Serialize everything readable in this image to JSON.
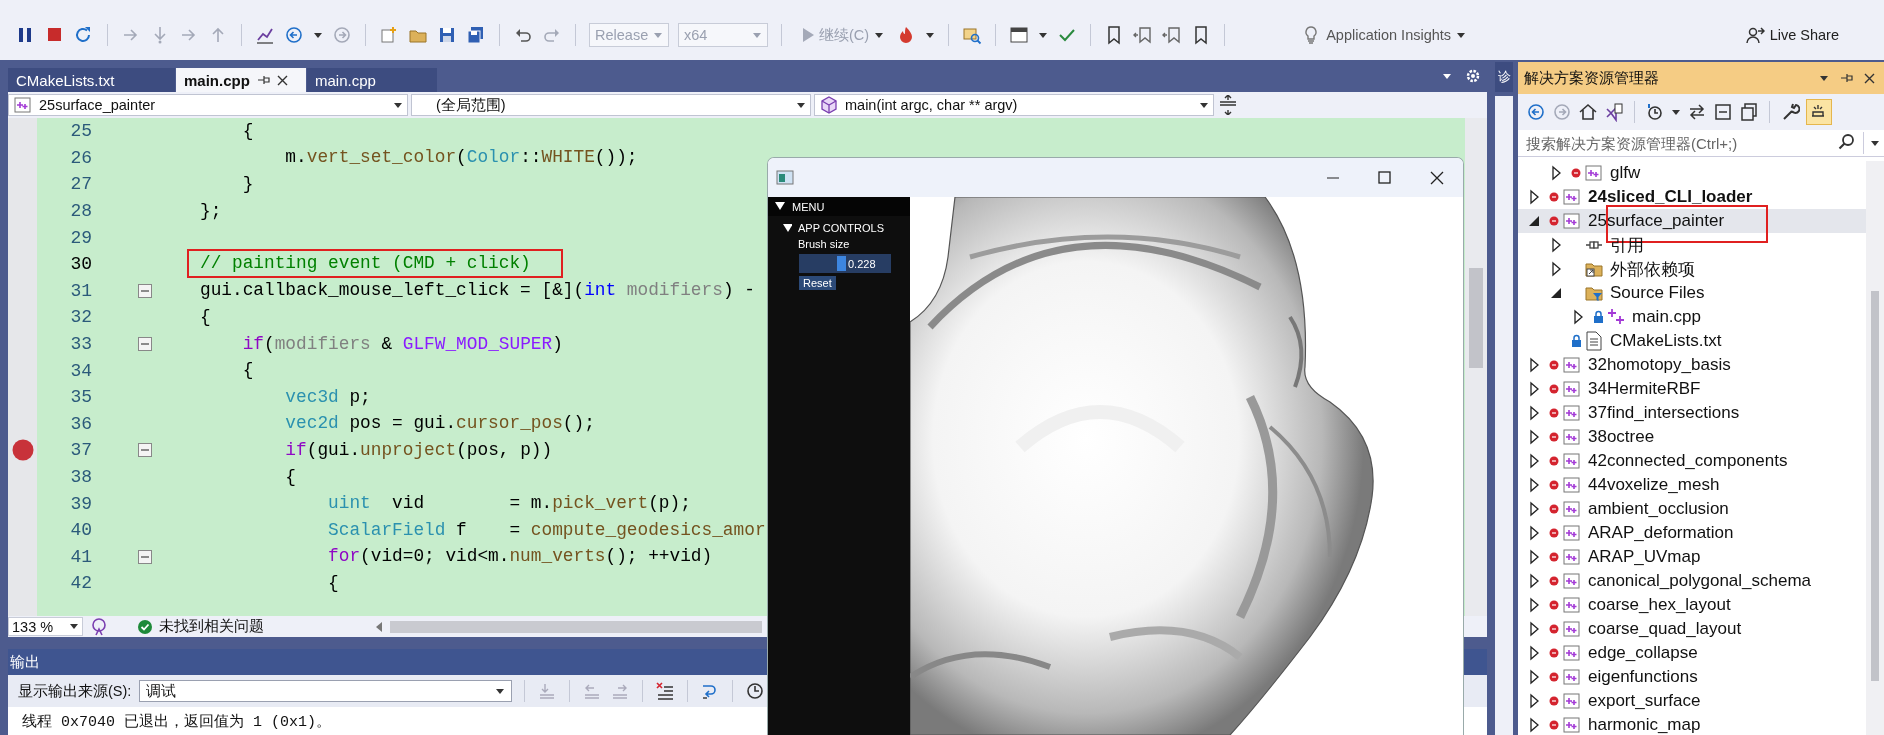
{
  "toolbar": {
    "config": {
      "value": "Release",
      "disabled": true
    },
    "platform": {
      "value": "x64",
      "disabled": true
    },
    "continue_button": "继续(C)",
    "insights": "Application Insights",
    "live_share": "Live Share"
  },
  "editor_tabs": [
    {
      "label": "CMakeLists.txt",
      "selected": false
    },
    {
      "label": "main.cpp",
      "selected": true
    },
    {
      "label": "main.cpp",
      "selected": false
    }
  ],
  "nav_bar": {
    "project": "25surface_painter",
    "scope": "(全局范围)",
    "member": "main(int argc, char ** argv)"
  },
  "code_lines": [
    {
      "number": "25",
      "tokens": [
        {
          "text": "    {",
          "kind": "plain"
        }
      ]
    },
    {
      "number": "26",
      "tokens": [
        {
          "text": "        m.",
          "kind": "plain"
        },
        {
          "text": "vert_set_color",
          "kind": "func"
        },
        {
          "text": "(",
          "kind": "plain"
        },
        {
          "text": "Color",
          "kind": "type"
        },
        {
          "text": "::",
          "kind": "plain"
        },
        {
          "text": "WHITE",
          "kind": "func"
        },
        {
          "text": "());",
          "kind": "plain"
        }
      ]
    },
    {
      "number": "27",
      "tokens": [
        {
          "text": "    }",
          "kind": "plain"
        }
      ]
    },
    {
      "number": "28",
      "tokens": [
        {
          "text": "};",
          "kind": "plain"
        }
      ]
    },
    {
      "number": "29"
    },
    {
      "number": "30",
      "current": true,
      "annotated": true,
      "tokens": [
        {
          "text": "// painting event (CMD + click)",
          "kind": "comment"
        }
      ]
    },
    {
      "number": "31",
      "fold": true,
      "tokens": [
        {
          "text": "gui.callback_mouse_left_click = [&](",
          "kind": "plain"
        },
        {
          "text": "int",
          "kind": "keyword"
        },
        {
          "text": " modifiers",
          "kind": "param"
        },
        {
          "text": ") -",
          "kind": "plain"
        }
      ]
    },
    {
      "number": "32",
      "tokens": [
        {
          "text": "{",
          "kind": "plain"
        }
      ]
    },
    {
      "number": "33",
      "fold": true,
      "tokens": [
        {
          "text": "    if",
          "kind": "control"
        },
        {
          "text": "(",
          "kind": "plain"
        },
        {
          "text": "modifiers",
          "kind": "param"
        },
        {
          "text": " & ",
          "kind": "plain"
        },
        {
          "text": "GLFW_MOD_SUPER",
          "kind": "macro"
        },
        {
          "text": ")",
          "kind": "plain"
        }
      ]
    },
    {
      "number": "34",
      "tokens": [
        {
          "text": "    {",
          "kind": "plain"
        }
      ]
    },
    {
      "number": "35",
      "tokens": [
        {
          "text": "        vec3d",
          "kind": "type"
        },
        {
          "text": " p;",
          "kind": "plain"
        }
      ]
    },
    {
      "number": "36",
      "tokens": [
        {
          "text": "        vec2d",
          "kind": "type"
        },
        {
          "text": " pos = gui.",
          "kind": "plain"
        },
        {
          "text": "cursor_pos",
          "kind": "func"
        },
        {
          "text": "();",
          "kind": "plain"
        }
      ]
    },
    {
      "number": "37",
      "fold": true,
      "breakpoint": true,
      "tokens": [
        {
          "text": "        if",
          "kind": "control"
        },
        {
          "text": "(gui.",
          "kind": "plain"
        },
        {
          "text": "unproject",
          "kind": "func"
        },
        {
          "text": "(pos, p))",
          "kind": "plain"
        }
      ]
    },
    {
      "number": "38",
      "tokens": [
        {
          "text": "        {",
          "kind": "plain"
        }
      ]
    },
    {
      "number": "39",
      "tokens": [
        {
          "text": "            uint",
          "kind": "type"
        },
        {
          "text": "  vid        = m.",
          "kind": "plain"
        },
        {
          "text": "pick_vert",
          "kind": "func"
        },
        {
          "text": "(p);",
          "kind": "plain"
        }
      ]
    },
    {
      "number": "40",
      "tokens": [
        {
          "text": "            ScalarField",
          "kind": "type"
        },
        {
          "text": " f    = ",
          "kind": "plain"
        },
        {
          "text": "compute_geodesics_amor",
          "kind": "func"
        }
      ]
    },
    {
      "number": "41",
      "fold": true,
      "tokens": [
        {
          "text": "            for",
          "kind": "control"
        },
        {
          "text": "(vid=0; vid<m.",
          "kind": "plain"
        },
        {
          "text": "num_verts",
          "kind": "func"
        },
        {
          "text": "(); ++vid)",
          "kind": "plain"
        }
      ]
    },
    {
      "number": "42",
      "tokens": [
        {
          "text": "            {",
          "kind": "plain"
        }
      ]
    }
  ],
  "editor_status": {
    "zoom": "133 %",
    "issues": "未找到相关问题"
  },
  "output": {
    "title": "输出",
    "source_label": "显示输出来源(S):",
    "source": "调试",
    "lines": [
      "线程 0x7040 已退出，返回值为 1 (0x1)。"
    ]
  },
  "side_tab": "诊",
  "solution_explorer": {
    "title": "解决方案资源管理器",
    "search_placeholder": "搜索解决方案资源管理器(Ctrl+;)",
    "tree": [
      {
        "children": [
          {
            "label": "glfw",
            "kind": "project",
            "marked": true,
            "expanded": false,
            "selected": false
          }
        ]
      },
      {
        "label": "24sliced_CLI_loader",
        "kind": "project",
        "marked": true,
        "bold": true,
        "expanded": false,
        "selected": false
      },
      {
        "label": "25surface_painter",
        "kind": "project",
        "marked": true,
        "bold": false,
        "expanded": true,
        "selected": true,
        "annotated": true,
        "children": [
          {
            "label": "引用",
            "kind": "references",
            "expanded": false,
            "selected": false
          },
          {
            "label": "外部依赖项",
            "kind": "external",
            "expanded": false,
            "selected": false
          },
          {
            "label": "Source Files",
            "kind": "filter",
            "expanded": true,
            "selected": false,
            "children": [
              {
                "label": "main.cpp",
                "kind": "cpp",
                "locked": true,
                "expanded": false,
                "selected": false
              }
            ]
          },
          {
            "label": "CMakeLists.txt",
            "kind": "text",
            "locked": true,
            "selected": false
          }
        ]
      },
      {
        "label": "32homotopy_basis",
        "kind": "project",
        "marked": true,
        "bold": false,
        "expanded": false,
        "selected": false
      },
      {
        "label": "34HermiteRBF",
        "kind": "project",
        "marked": true,
        "bold": false,
        "expanded": false,
        "selected": false
      },
      {
        "label": "37find_intersections",
        "kind": "project",
        "marked": true,
        "bold": false,
        "expanded": false,
        "selected": false
      },
      {
        "label": "38octree",
        "kind": "project",
        "marked": true,
        "bold": false,
        "expanded": false,
        "selected": false
      },
      {
        "label": "42connected_components",
        "kind": "project",
        "marked": true,
        "bold": false,
        "expanded": false,
        "selected": false
      },
      {
        "label": "44voxelize_mesh",
        "kind": "project",
        "marked": true,
        "bold": false,
        "expanded": false,
        "selected": false
      },
      {
        "label": "ambient_occlusion",
        "kind": "project",
        "marked": true,
        "bold": false,
        "expanded": false,
        "selected": false
      },
      {
        "label": "ARAP_deformation",
        "kind": "project",
        "marked": true,
        "bold": false,
        "expanded": false,
        "selected": false
      },
      {
        "label": "ARAP_UVmap",
        "kind": "project",
        "marked": true,
        "bold": false,
        "expanded": false,
        "selected": false
      },
      {
        "label": "canonical_polygonal_schema",
        "kind": "project",
        "marked": true,
        "bold": false,
        "expanded": false,
        "selected": false
      },
      {
        "label": "coarse_hex_layout",
        "kind": "project",
        "marked": true,
        "bold": false,
        "expanded": false,
        "selected": false
      },
      {
        "label": "coarse_quad_layout",
        "kind": "project",
        "marked": true,
        "bold": false,
        "expanded": false,
        "selected": false
      },
      {
        "label": "edge_collapse",
        "kind": "project",
        "marked": true,
        "bold": false,
        "expanded": false,
        "selected": false
      },
      {
        "label": "eigenfunctions",
        "kind": "project",
        "marked": true,
        "bold": false,
        "expanded": false,
        "selected": false
      },
      {
        "label": "export_surface",
        "kind": "project",
        "marked": true,
        "bold": false,
        "expanded": false,
        "selected": false
      },
      {
        "label": "harmonic_map",
        "kind": "project",
        "marked": true,
        "bold": false,
        "expanded": false,
        "selected": false
      }
    ]
  },
  "app_window": {
    "menu": {
      "label": "MENU",
      "expanded": true
    },
    "section": {
      "label": "APP CONTROLS",
      "expanded": true
    },
    "slider": {
      "label": "Brush size",
      "value": "0.228",
      "level": 0.46
    },
    "reset": "Reset"
  }
}
